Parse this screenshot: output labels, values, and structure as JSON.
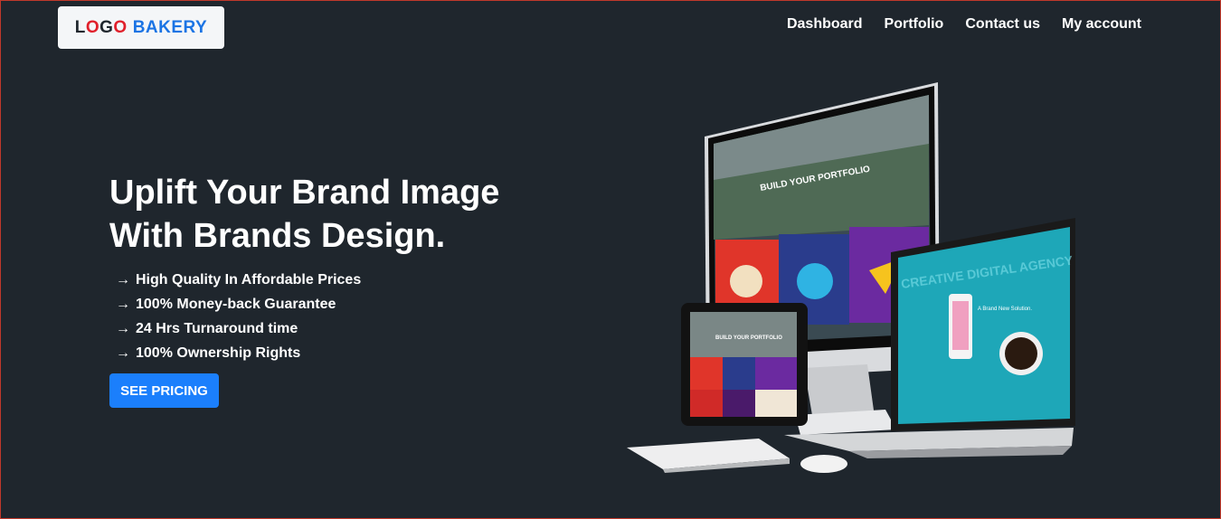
{
  "header": {
    "logo": {
      "part1": "L",
      "part2": "O",
      "part3": "G",
      "part4": "O",
      "brand": "BAKERY"
    },
    "nav": [
      {
        "label": "Dashboard"
      },
      {
        "label": "Portfolio"
      },
      {
        "label": "Contact us"
      },
      {
        "label": "My account"
      }
    ]
  },
  "hero": {
    "title_line1": "Uplift Your Brand Image",
    "title_line2": "With Brands Design.",
    "features": [
      "High Quality In Affordable Prices",
      "100% Money-back Guarantee",
      "24 Hrs Turnaround time",
      "100% Ownership Rights"
    ],
    "cta_label": "SEE PRICING",
    "mockup": {
      "monitor_heading": "BUILD YOUR PORTFOLIO",
      "tablet_heading": "BUILD YOUR PORTFOLIO",
      "laptop_text": "CREATIVE DIGITAL AGENCY",
      "laptop_subtext": "A Brand New Solution."
    }
  },
  "colors": {
    "background": "#1f262d",
    "accent": "#1b7ffc",
    "logo_red": "#e0202b",
    "logo_blue": "#1b74e4"
  }
}
